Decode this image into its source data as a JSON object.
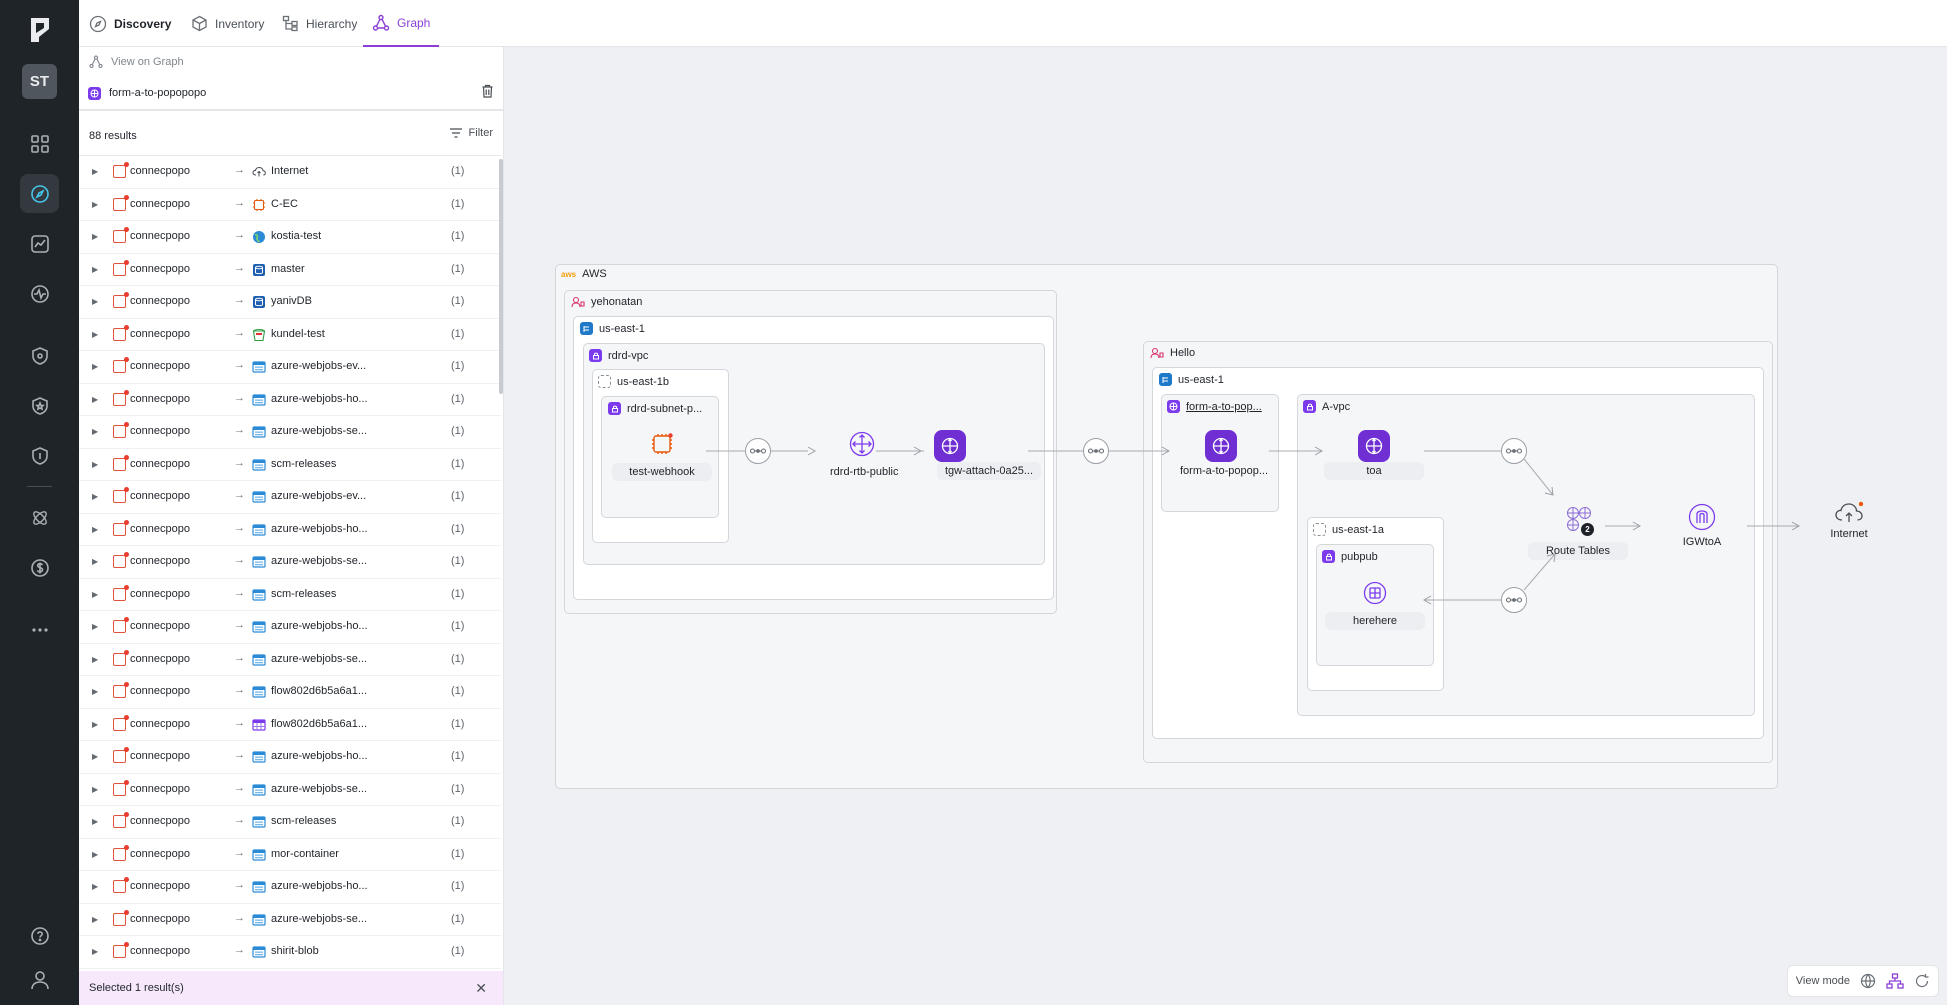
{
  "rail": {
    "avatar_initials": "ST",
    "items": [
      "dashboard-icon",
      "compass-icon",
      "analytics-icon",
      "activity-icon",
      "shield-icon",
      "shield-star-icon",
      "shield-lock-icon",
      "atom-icon",
      "dollar-icon",
      "more-icon"
    ],
    "bottom": [
      "help-icon",
      "user-icon"
    ]
  },
  "topnav": {
    "tabs": [
      {
        "label": "Discovery",
        "icon": "compass-icon"
      },
      {
        "label": "Inventory",
        "icon": "cube-icon"
      },
      {
        "label": "Hierarchy",
        "icon": "hierarchy-icon"
      },
      {
        "label": "Graph",
        "icon": "graph-icon"
      }
    ],
    "active_tab": "Graph",
    "accent": "#8c3fd6"
  },
  "panel": {
    "view_on_graph": "View on Graph",
    "query_name": "form-a-to-popopopo",
    "results_count": "88 results",
    "filter_label": "Filter",
    "rows": [
      {
        "src": "connecpopo",
        "dst": "Internet",
        "dst_icon": "cloud-icon",
        "count": "(1)"
      },
      {
        "src": "connecpopo",
        "dst": "C-EC",
        "dst_icon": "ec2-icon",
        "count": "(1)"
      },
      {
        "src": "connecpopo",
        "dst": "kostia-test",
        "dst_icon": "globe-icon",
        "count": "(1)"
      },
      {
        "src": "connecpopo",
        "dst": "master",
        "dst_icon": "database-icon",
        "count": "(1)"
      },
      {
        "src": "connecpopo",
        "dst": "yanivDB",
        "dst_icon": "database-icon",
        "count": "(1)"
      },
      {
        "src": "connecpopo",
        "dst": "kundel-test",
        "dst_icon": "bucket-icon",
        "count": "(1)"
      },
      {
        "src": "connecpopo",
        "dst": "azure-webjobs-ev...",
        "dst_icon": "storage-icon",
        "count": "(1)"
      },
      {
        "src": "connecpopo",
        "dst": "azure-webjobs-ho...",
        "dst_icon": "storage-icon",
        "count": "(1)"
      },
      {
        "src": "connecpopo",
        "dst": "azure-webjobs-se...",
        "dst_icon": "storage-icon",
        "count": "(1)"
      },
      {
        "src": "connecpopo",
        "dst": "scm-releases",
        "dst_icon": "storage-icon",
        "count": "(1)"
      },
      {
        "src": "connecpopo",
        "dst": "azure-webjobs-ev...",
        "dst_icon": "storage-icon",
        "count": "(1)"
      },
      {
        "src": "connecpopo",
        "dst": "azure-webjobs-ho...",
        "dst_icon": "storage-icon",
        "count": "(1)"
      },
      {
        "src": "connecpopo",
        "dst": "azure-webjobs-se...",
        "dst_icon": "storage-icon",
        "count": "(1)"
      },
      {
        "src": "connecpopo",
        "dst": "scm-releases",
        "dst_icon": "storage-icon",
        "count": "(1)"
      },
      {
        "src": "connecpopo",
        "dst": "azure-webjobs-ho...",
        "dst_icon": "storage-icon",
        "count": "(1)"
      },
      {
        "src": "connecpopo",
        "dst": "azure-webjobs-se...",
        "dst_icon": "storage-icon",
        "count": "(1)"
      },
      {
        "src": "connecpopo",
        "dst": "flow802d6b5a6a1...",
        "dst_icon": "storage-icon",
        "count": "(1)"
      },
      {
        "src": "connecpopo",
        "dst": "flow802d6b5a6a1...",
        "dst_icon": "table-icon",
        "count": "(1)"
      },
      {
        "src": "connecpopo",
        "dst": "azure-webjobs-ho...",
        "dst_icon": "storage-icon",
        "count": "(1)"
      },
      {
        "src": "connecpopo",
        "dst": "azure-webjobs-se...",
        "dst_icon": "storage-icon",
        "count": "(1)"
      },
      {
        "src": "connecpopo",
        "dst": "scm-releases",
        "dst_icon": "storage-icon",
        "count": "(1)"
      },
      {
        "src": "connecpopo",
        "dst": "mor-container",
        "dst_icon": "storage-icon",
        "count": "(1)"
      },
      {
        "src": "connecpopo",
        "dst": "azure-webjobs-ho...",
        "dst_icon": "storage-icon",
        "count": "(1)"
      },
      {
        "src": "connecpopo",
        "dst": "azure-webjobs-se...",
        "dst_icon": "storage-icon",
        "count": "(1)"
      },
      {
        "src": "connecpopo",
        "dst": "shirit-blob",
        "dst_icon": "storage-icon",
        "count": "(1)"
      }
    ],
    "selection_text": "Selected 1 result(s)"
  },
  "graph": {
    "aws_label": "AWS",
    "aws_badge": "aws",
    "account1": "yehonatan",
    "region1": "us-east-1",
    "vpc1": "rdrd-vpc",
    "az1": "us-east-1b",
    "subnet1": "rdrd-subnet-p...",
    "instance": "test-webhook",
    "route_table": "rdrd-rtb-public",
    "tgw_attach": "tgw-attach-0a25...",
    "account2": "Hello",
    "region2": "us-east-1",
    "tgw_box": "form-a-to-pop...",
    "tgw_node": "form-a-to-popop...",
    "vpc2": "A-vpc",
    "toa": "toa",
    "az2": "us-east-1a",
    "subnet2": "pubpub",
    "herehere": "herehere",
    "route_tables": "Route Tables",
    "route_tables_count": "2",
    "igw": "IGWtoA",
    "internet": "Internet"
  },
  "viewmode": {
    "label": "View mode"
  }
}
